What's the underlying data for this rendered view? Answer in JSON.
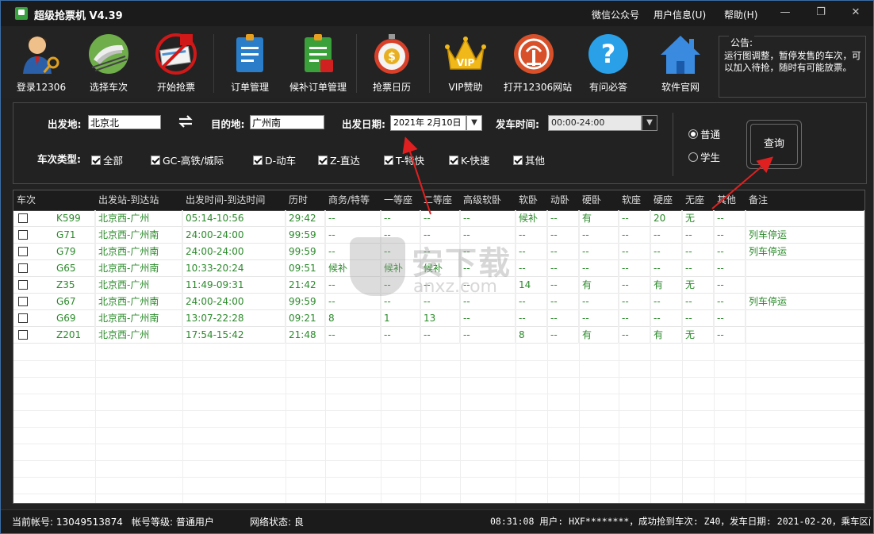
{
  "app": {
    "title": "超级抢票机 V4.39",
    "menu": [
      "微信公众号",
      "用户信息(U)",
      "帮助(H)"
    ],
    "window_buttons": [
      "—",
      "❐",
      "✕"
    ]
  },
  "toolbar": [
    {
      "label": "登录12306",
      "icon": "user-key-icon"
    },
    {
      "label": "选择车次",
      "icon": "train-icon"
    },
    {
      "label": "开始抢票",
      "icon": "ticket-grab-icon"
    },
    {
      "label": "订单管理",
      "icon": "order-doc-icon"
    },
    {
      "label": "候补订单管理",
      "icon": "waitlist-doc-icon"
    },
    {
      "label": "抢票日历",
      "icon": "stopwatch-icon"
    },
    {
      "label": "VIP赞助",
      "icon": "vip-crown-icon"
    },
    {
      "label": "打开12306网站",
      "icon": "railway-logo-icon"
    },
    {
      "label": "有问必答",
      "icon": "question-icon"
    },
    {
      "label": "软件官网",
      "icon": "home-icon"
    }
  ],
  "notice": {
    "title": "公告:",
    "text": "运行图调整，暂停发售的车次，可以加入待抢，随时有可能放票。"
  },
  "query": {
    "from_label": "出发地:",
    "from_value": "北京北",
    "to_label": "目的地:",
    "to_value": "广州南",
    "date_label": "出发日期:",
    "date_value": "2021年 2月10日",
    "time_label": "发车时间:",
    "time_value": "00:00-24:00",
    "type_label": "车次类型:",
    "types": [
      "全部",
      "GC-高铁/城际",
      "D-动车",
      "Z-直达",
      "T-特快",
      "K-快速",
      "其他"
    ],
    "passenger_types": [
      "普通",
      "学生"
    ],
    "selected_passenger": "普通",
    "query_button": "查询"
  },
  "table": {
    "columns": [
      "车次",
      "出发站-到达站",
      "出发时间-到达时间",
      "历时",
      "商务/特等",
      "一等座",
      "二等座",
      "高级软卧",
      "软卧",
      "动卧",
      "硬卧",
      "软座",
      "硬座",
      "无座",
      "其他",
      "备注"
    ],
    "rows": [
      [
        "K599",
        "北京西-广州",
        "05:14-10:56",
        "29:42",
        "--",
        "--",
        "--",
        "--",
        "候补",
        "--",
        "有",
        "--",
        "20",
        "无",
        "--",
        ""
      ],
      [
        "G71",
        "北京西-广州南",
        "24:00-24:00",
        "99:59",
        "--",
        "--",
        "--",
        "--",
        "--",
        "--",
        "--",
        "--",
        "--",
        "--",
        "--",
        "列车停运"
      ],
      [
        "G79",
        "北京西-广州南",
        "24:00-24:00",
        "99:59",
        "--",
        "--",
        "--",
        "--",
        "--",
        "--",
        "--",
        "--",
        "--",
        "--",
        "--",
        "列车停运"
      ],
      [
        "G65",
        "北京西-广州南",
        "10:33-20:24",
        "09:51",
        "候补",
        "候补",
        "候补",
        "--",
        "--",
        "--",
        "--",
        "--",
        "--",
        "--",
        "--",
        ""
      ],
      [
        "Z35",
        "北京西-广州",
        "11:49-09:31",
        "21:42",
        "--",
        "--",
        "--",
        "--",
        "14",
        "--",
        "有",
        "--",
        "有",
        "无",
        "--",
        ""
      ],
      [
        "G67",
        "北京西-广州南",
        "24:00-24:00",
        "99:59",
        "--",
        "--",
        "--",
        "--",
        "--",
        "--",
        "--",
        "--",
        "--",
        "--",
        "--",
        "列车停运"
      ],
      [
        "G69",
        "北京西-广州南",
        "13:07-22:28",
        "09:21",
        "8",
        "1",
        "13",
        "--",
        "--",
        "--",
        "--",
        "--",
        "--",
        "--",
        "--",
        ""
      ],
      [
        "Z201",
        "北京西-广州",
        "17:54-15:42",
        "21:48",
        "--",
        "--",
        "--",
        "--",
        "8",
        "--",
        "有",
        "--",
        "有",
        "无",
        "--",
        ""
      ]
    ]
  },
  "watermark": {
    "title": "安下载",
    "sub": "anxz.com"
  },
  "status": {
    "account": "当前帐号: 13049513874",
    "level": "帐号等级: 普通用户",
    "network": "网络状态: 良",
    "log": "08:31:08 用户: HXF********，成功抢到车次: Z40，发车日期: 2021-02-20，乘车区间: 广"
  },
  "colors": {
    "accent_green": "#2a8a2a",
    "annotation_red": "#e02020",
    "background": "#1e1e1e"
  }
}
